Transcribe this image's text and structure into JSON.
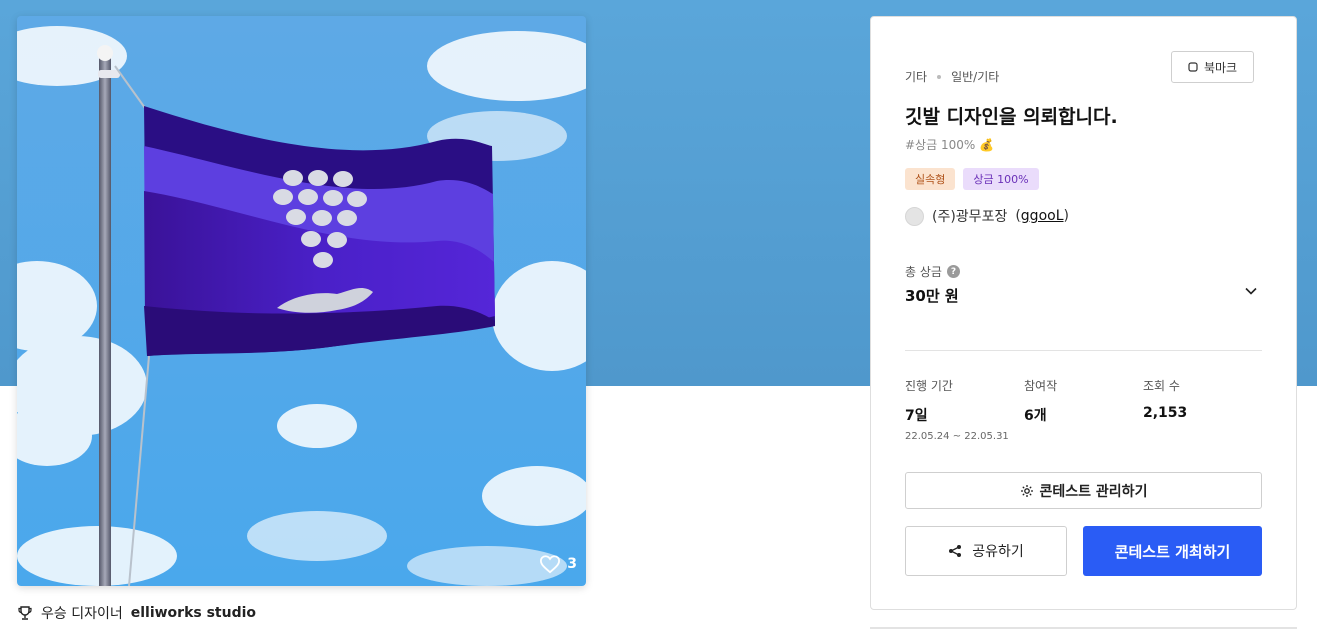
{
  "image": {
    "likes": "3"
  },
  "winner": {
    "label": "우승 디자이너",
    "name": "elliworks studio"
  },
  "panel": {
    "category": "기타",
    "subcategory": "일반/기타",
    "bookmark_label": "북마크",
    "title": "깃발 디자인을 의뢰합니다.",
    "hashtag": "#상금 100% 💰",
    "badges": [
      "실속형",
      "상금 100%"
    ],
    "host_company": "(주)광무포장",
    "host_user": "ggooL",
    "prize_label": "총 상금",
    "prize_value": "30만 원",
    "stats": {
      "period_label": "진행 기간",
      "period_value": "7일",
      "period_dates": "22.05.24 ~ 22.05.31",
      "participants_label": "참여작",
      "participants_value": "6개",
      "views_label": "조회 수",
      "views_value": "2,153"
    },
    "manage_label": "콘테스트 관리하기",
    "share_label": "공유하기",
    "host_contest_label": "콘테스트 개최하기"
  },
  "colors": {
    "primary": "#2a5cf5",
    "hero_bg": "#5aa6da",
    "flag_purple": "#3b12a8"
  }
}
